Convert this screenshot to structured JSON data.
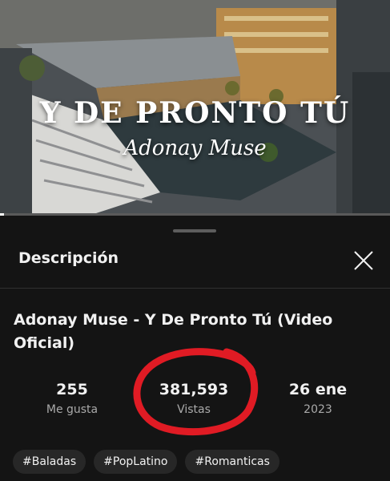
{
  "video": {
    "title_overlay": "Y DE PRONTO TÚ",
    "artist_overlay": "Adonay Muse",
    "progress_fraction": 0.01
  },
  "panel": {
    "heading": "Descripción",
    "close_icon": "close-icon",
    "video_title": "Adonay Muse - Y De Pronto Tú (Video Oficial)",
    "stats": {
      "likes_value": "255",
      "likes_label": "Me gusta",
      "views_value": "381,593",
      "views_label": "Vistas",
      "date_value": "26 ene",
      "date_year": "2023"
    },
    "tags": [
      "#Baladas",
      "#PopLatino",
      "#Romanticas"
    ]
  },
  "colors": {
    "background": "#0f0f0f",
    "panel": "#141414",
    "chip": "#272727",
    "annotation_circle": "#e01b24"
  }
}
